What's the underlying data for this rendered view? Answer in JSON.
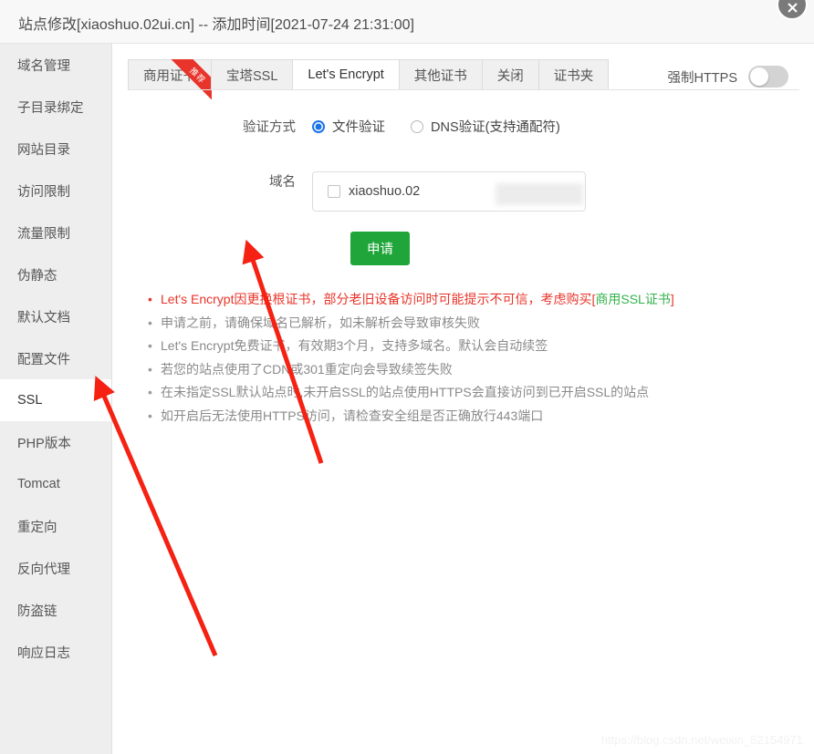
{
  "window": {
    "title": "站点修改[xiaoshuo.02ui.cn] -- 添加时间[2021-07-24 21:31:00]",
    "close_icon": "close-icon"
  },
  "sidebar": {
    "items": [
      {
        "label": "域名管理",
        "active": false
      },
      {
        "label": "子目录绑定",
        "active": false
      },
      {
        "label": "网站目录",
        "active": false
      },
      {
        "label": "访问限制",
        "active": false
      },
      {
        "label": "流量限制",
        "active": false
      },
      {
        "label": "伪静态",
        "active": false
      },
      {
        "label": "默认文档",
        "active": false
      },
      {
        "label": "配置文件",
        "active": false
      },
      {
        "label": "SSL",
        "active": true
      },
      {
        "label": "PHP版本",
        "active": false
      },
      {
        "label": "Tomcat",
        "active": false
      },
      {
        "label": "重定向",
        "active": false
      },
      {
        "label": "反向代理",
        "active": false
      },
      {
        "label": "防盗链",
        "active": false
      },
      {
        "label": "响应日志",
        "active": false
      }
    ]
  },
  "tabs": [
    {
      "label": "商用证书",
      "active": false,
      "ribbon": "推荐"
    },
    {
      "label": "宝塔SSL",
      "active": false,
      "ribbon": ""
    },
    {
      "label": "Let's Encrypt",
      "active": true,
      "ribbon": ""
    },
    {
      "label": "其他证书",
      "active": false,
      "ribbon": ""
    },
    {
      "label": "关闭",
      "active": false,
      "ribbon": ""
    },
    {
      "label": "证书夹",
      "active": false,
      "ribbon": ""
    }
  ],
  "https_toggle": {
    "label": "强制HTTPS",
    "state": "off"
  },
  "verify": {
    "label": "验证方式",
    "options": [
      {
        "label": "文件验证",
        "selected": true
      },
      {
        "label": "DNS验证(支持通配符)",
        "selected": false
      }
    ]
  },
  "domain": {
    "label": "域名",
    "value": "xiaoshuo.02",
    "checked": false
  },
  "apply_button": {
    "label": "申请",
    "color": "#20a53a"
  },
  "notes": [
    {
      "warn": true,
      "prefix": "Let's Encrypt因更换根证书，部分老旧设备访问时可能提示不可信，考虑购买[",
      "link": "商用SSL证书",
      "suffix": "]"
    },
    {
      "warn": false,
      "prefix": "申请之前，请确保域名已解析，如未解析会导致审核失败",
      "link": "",
      "suffix": ""
    },
    {
      "warn": false,
      "prefix": "Let's Encrypt免费证书，有效期3个月，支持多域名。默认会自动续签",
      "link": "",
      "suffix": ""
    },
    {
      "warn": false,
      "prefix": "若您的站点使用了CDN或301重定向会导致续签失败",
      "link": "",
      "suffix": ""
    },
    {
      "warn": false,
      "prefix": "在未指定SSL默认站点时,未开启SSL的站点使用HTTPS会直接访问到已开启SSL的站点",
      "link": "",
      "suffix": ""
    },
    {
      "warn": false,
      "prefix": "如开启后无法使用HTTPS访问，请检查安全组是否正确放行443端口",
      "link": "",
      "suffix": ""
    }
  ],
  "watermark": "https://blog.csdn.net/weixin_52154971",
  "annotations": {
    "color": "#f52112",
    "arrow_to_ssl": "红色箭头指向 SSL",
    "arrow_to_apply": "红色箭头指向 申请"
  }
}
